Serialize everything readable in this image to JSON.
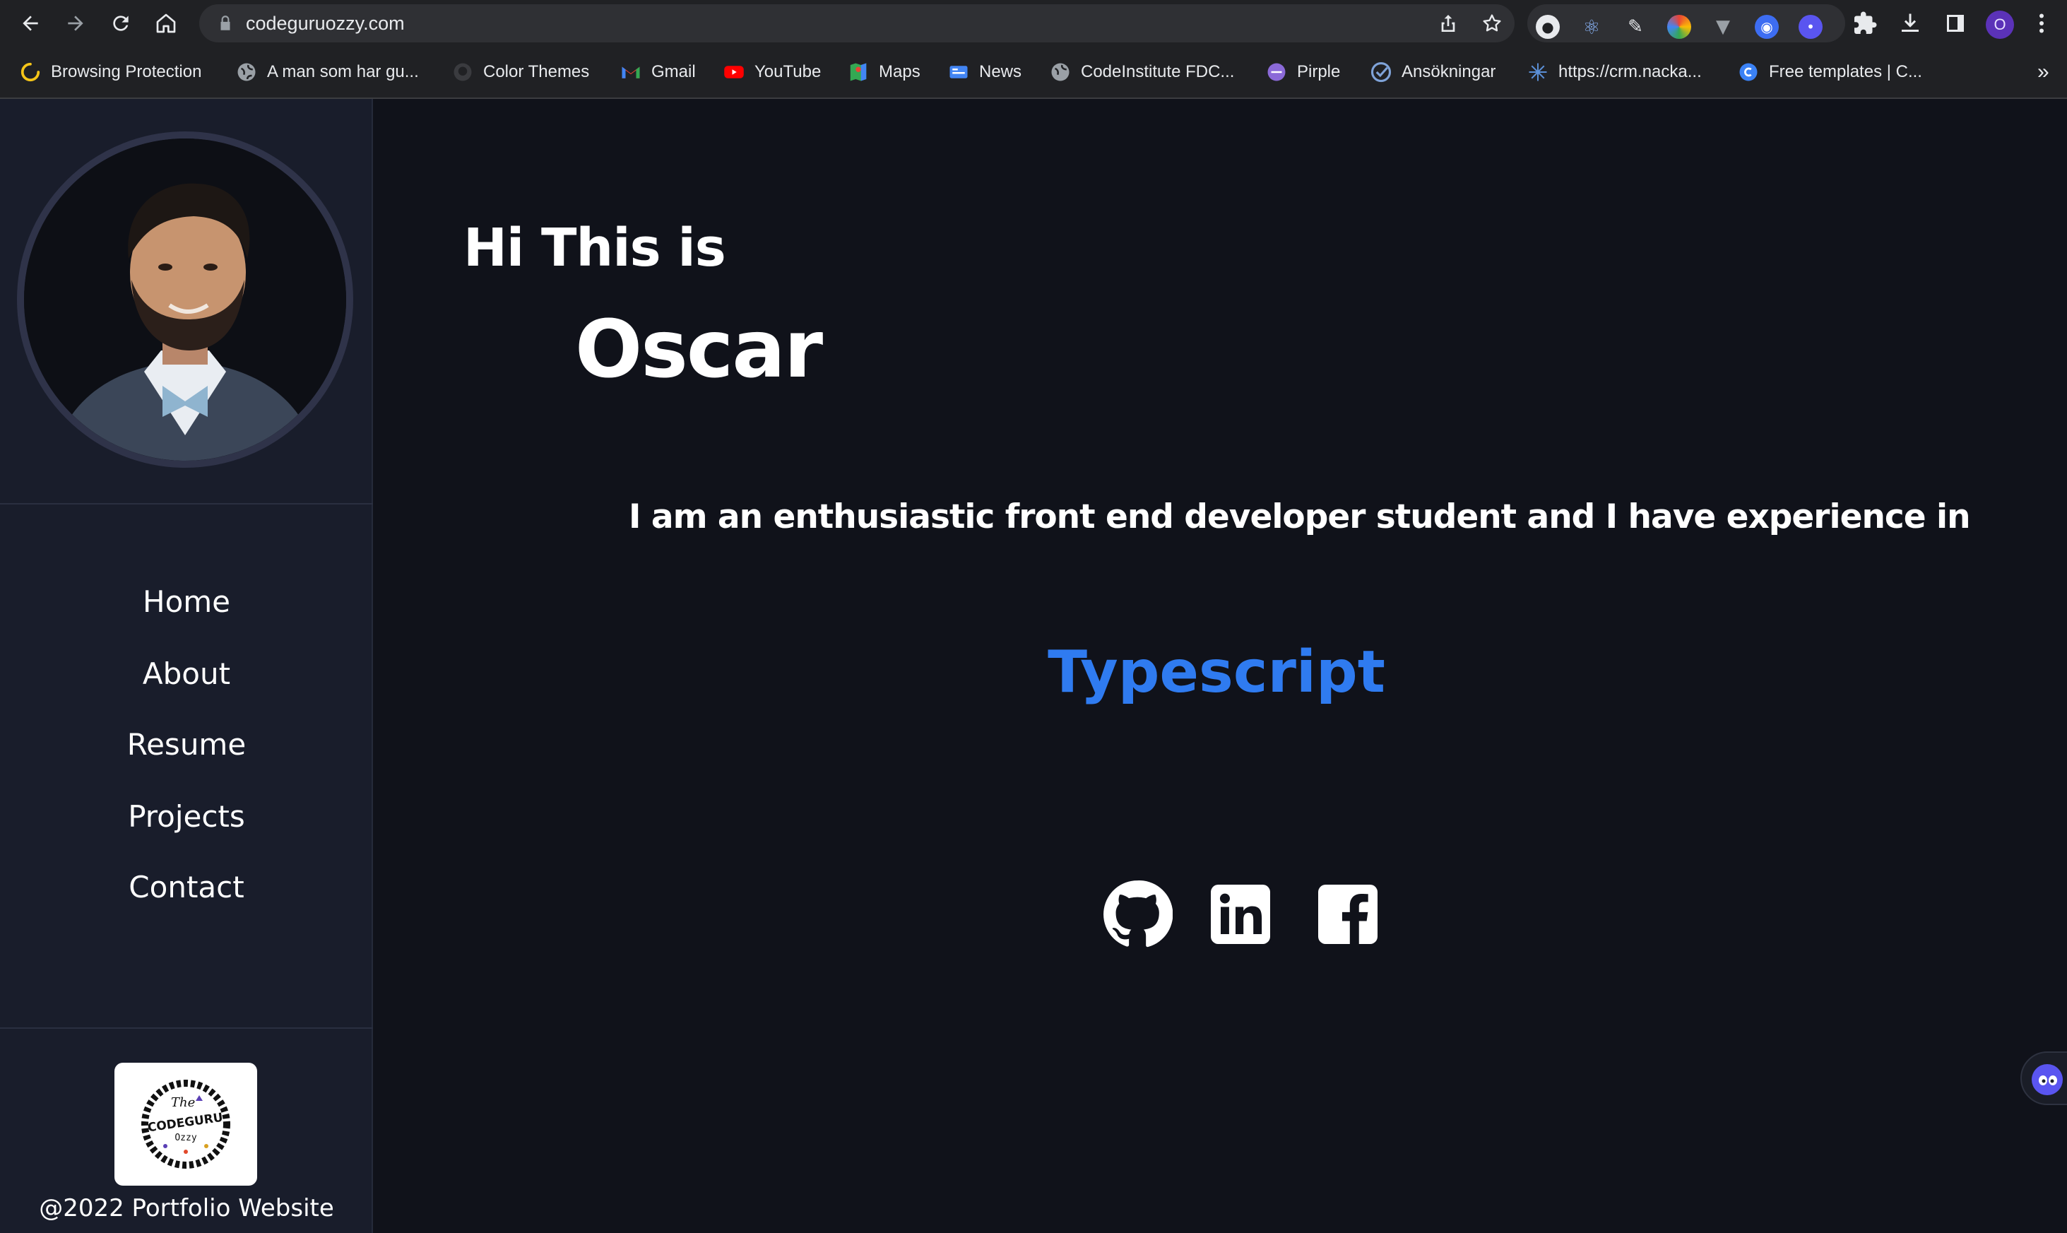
{
  "browser": {
    "url": "codeguruozzy.com",
    "profile_initial": "O",
    "bookmarks": [
      {
        "label": "Browsing Protection",
        "icon": "spinner-icon"
      },
      {
        "label": "A man som har gu...",
        "icon": "globe-icon"
      },
      {
        "label": "Color Themes",
        "icon": "github-icon"
      },
      {
        "label": "Gmail",
        "icon": "gmail-icon"
      },
      {
        "label": "YouTube",
        "icon": "youtube-icon"
      },
      {
        "label": "Maps",
        "icon": "maps-icon"
      },
      {
        "label": "News",
        "icon": "news-icon"
      },
      {
        "label": "CodeInstitute FDC...",
        "icon": "globe-icon"
      },
      {
        "label": "Pirple",
        "icon": "pirple-icon"
      },
      {
        "label": "Ansökningar",
        "icon": "checkmark-icon"
      },
      {
        "label": "https://crm.nacka...",
        "icon": "sparkle-icon"
      },
      {
        "label": "Free templates | C...",
        "icon": "canva-icon"
      }
    ],
    "overflow_label": "»"
  },
  "sidebar": {
    "avatar_alt": "profile-photo",
    "nav": [
      {
        "label": "Home"
      },
      {
        "label": "About"
      },
      {
        "label": "Resume"
      },
      {
        "label": "Projects"
      },
      {
        "label": "Contact"
      }
    ],
    "logo": {
      "line1": "The",
      "line2": "CODEGURU",
      "line3": "Ozzy"
    },
    "footer": "@2022 Portfolio Website"
  },
  "main": {
    "greeting": "Hi This is",
    "name": "Oscar",
    "intro": "I am an enthusiastic front end developer student and I have experience in",
    "typed_skill": "Typescript",
    "social": [
      {
        "name": "github",
        "icon": "github-icon"
      },
      {
        "name": "linkedin",
        "icon": "linkedin-icon"
      },
      {
        "name": "facebook",
        "icon": "facebook-icon"
      }
    ]
  },
  "colors": {
    "page_bg": "#10121a",
    "sidebar_bg": "#191d2b",
    "accent": "#2f7bf0",
    "chrome_bg": "#202124"
  }
}
